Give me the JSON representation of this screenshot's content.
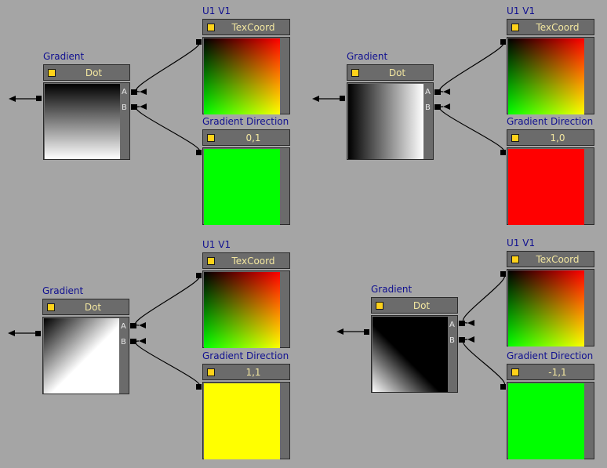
{
  "groups": [
    {
      "gradient": {
        "title": "Gradient",
        "label": "Dot",
        "port_a": "A",
        "port_b": "B"
      },
      "texcoord": {
        "title": "U1 V1",
        "label": "TexCoord"
      },
      "direction": {
        "title": "Gradient Direction",
        "label": "0,1",
        "color": "#00ff00"
      }
    },
    {
      "gradient": {
        "title": "Gradient",
        "label": "Dot",
        "port_a": "A",
        "port_b": "B"
      },
      "texcoord": {
        "title": "U1 V1",
        "label": "TexCoord"
      },
      "direction": {
        "title": "Gradient Direction",
        "label": "1,0",
        "color": "#ff0000"
      }
    },
    {
      "gradient": {
        "title": "Gradient",
        "label": "Dot",
        "port_a": "A",
        "port_b": "B"
      },
      "texcoord": {
        "title": "U1 V1",
        "label": "TexCoord"
      },
      "direction": {
        "title": "Gradient Direction",
        "label": "1,1",
        "color": "#ffff00"
      }
    },
    {
      "gradient": {
        "title": "Gradient",
        "label": "Dot",
        "port_a": "A",
        "port_b": "B"
      },
      "texcoord": {
        "title": "U1 V1",
        "label": "TexCoord"
      },
      "direction": {
        "title": "Gradient Direction",
        "label": "-1,1",
        "color": "#00ff00"
      }
    }
  ],
  "colors": {
    "background": "#a5a5a5",
    "node_body": "#6b6b6b",
    "title_text": "#101090",
    "header_text": "#f3e7a0",
    "indicator": "#ffd21a"
  }
}
